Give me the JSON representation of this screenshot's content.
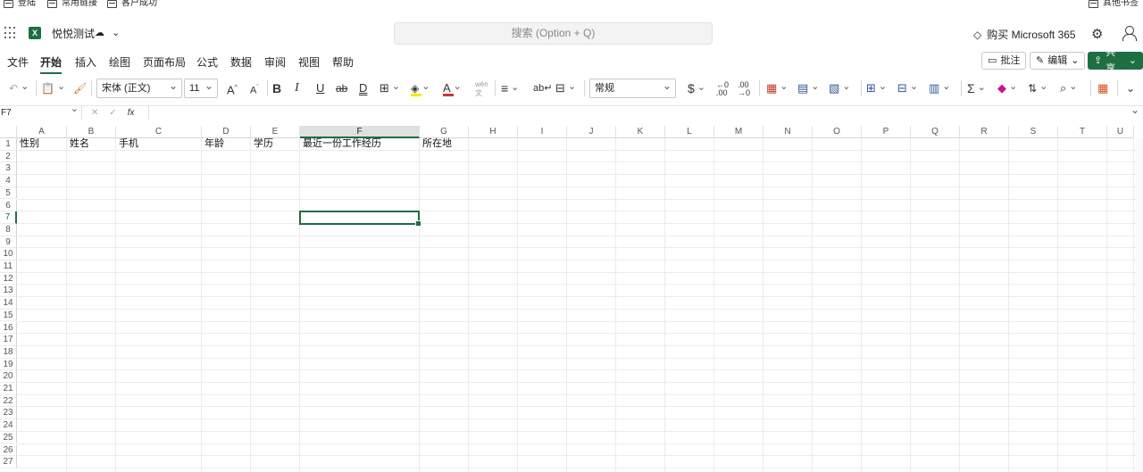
{
  "bookmarks": {
    "items": [
      "登陆",
      "常用链接",
      "客户成功"
    ],
    "other": "其他书签"
  },
  "app": {
    "logo": "X",
    "doc_title": "悦悦测试",
    "search_placeholder": "搜索 (Option + Q)",
    "buy_label": "购买 Microsoft 365"
  },
  "menu": {
    "tabs": [
      "文件",
      "开始",
      "插入",
      "绘图",
      "页面布局",
      "公式",
      "数据",
      "审阅",
      "视图",
      "帮助"
    ],
    "active_tab": "开始",
    "comment_label": "批注",
    "edit_label": "编辑",
    "share_label": "共享"
  },
  "ribbon": {
    "font_name": "宋体 (正文)",
    "font_size": "11",
    "grow_font": "A",
    "shrink_font": "A",
    "bold": "B",
    "italic": "I",
    "underline": "U",
    "strike": "ab",
    "double_underline": "D",
    "font_color_glyph": "A",
    "phonetic": "wén",
    "number_format": "常规",
    "currency": "$",
    "fill_color": "#ffe600",
    "font_color": "#d13438"
  },
  "formula_bar": {
    "name_box": "F7",
    "fx": "fx",
    "value": ""
  },
  "sheet": {
    "columns": [
      "A",
      "B",
      "C",
      "D",
      "E",
      "F",
      "G",
      "H",
      "I",
      "J",
      "K",
      "L",
      "M",
      "N",
      "O",
      "P",
      "Q",
      "R",
      "S",
      "T",
      "U"
    ],
    "rows": [
      "1",
      "2",
      "3",
      "4",
      "5",
      "6",
      "7",
      "8",
      "9",
      "10",
      "11",
      "12",
      "13",
      "14",
      "15",
      "16",
      "17",
      "18",
      "19",
      "20",
      "21",
      "22",
      "23",
      "24",
      "25",
      "26",
      "27"
    ],
    "selected_cell": "F7",
    "headers_row1": [
      "性别",
      "姓名",
      "手机",
      "年龄",
      "学历",
      "最近一份工作经历",
      "所在地"
    ],
    "accent": "#1d6f42"
  }
}
